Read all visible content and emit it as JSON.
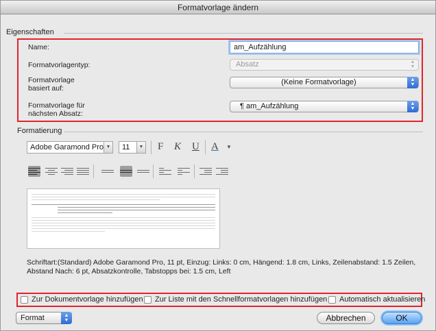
{
  "window": {
    "title": "Formatvorlage ändern"
  },
  "properties": {
    "group_label": "Eigenschaften",
    "name_label": "Name:",
    "name_value": "am_Aufzählung",
    "type_label": "Formatvorlagentyp:",
    "type_value": "Absatz",
    "based_on_label": "Formatvorlage\nbasiert auf:",
    "based_on_value": "(Keine Formatvorlage)",
    "next_label": "Formatvorlage für\nnächsten Absatz:",
    "next_value": "¶  am_Aufzählung"
  },
  "formatting": {
    "group_label": "Formatierung",
    "font": "Adobe Garamond Pro",
    "size": "11",
    "bold": "F",
    "italic": "K",
    "underline": "U",
    "font_color": "A"
  },
  "description": "Schriftart:(Standard) Adobe Garamond Pro, 11 pt, Einzug: Links:  0 cm, Hängend:  1.8 cm, Links, Zeilenabstand:  1.5 Zeilen, Abstand Nach:  6 pt, Absatzkontrolle, Tabstopps bei: 1.5 cm, Left",
  "options": {
    "add_to_template": "Zur Dokumentvorlage hinzufügen",
    "add_to_quick_styles": "Zur Liste mit den Schnellformatvorlagen hinzufügen",
    "auto_update": "Automatisch aktualisieren"
  },
  "footer": {
    "format_label": "Format",
    "cancel_label": "Abbrechen",
    "ok_label": "OK"
  },
  "colors": {
    "highlight": "#e0242b",
    "accent": "#2d6bd6"
  }
}
